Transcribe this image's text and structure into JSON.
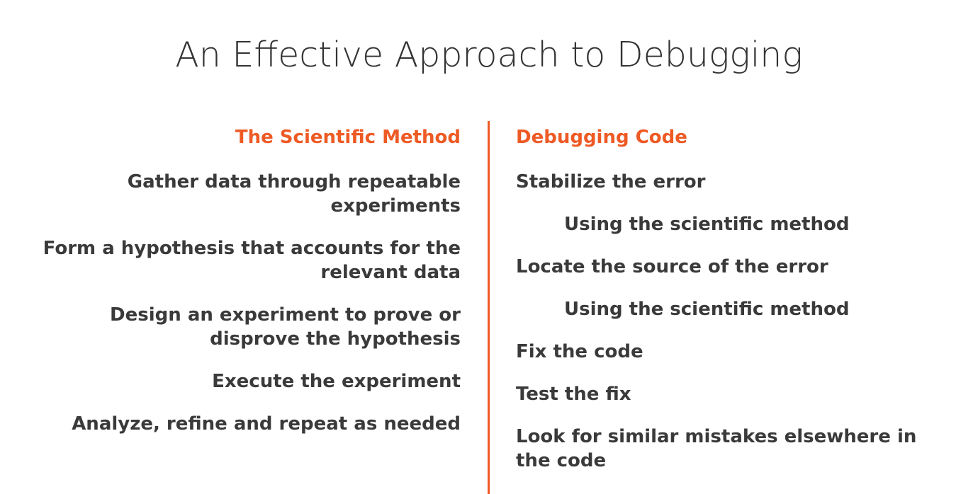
{
  "title": "An Effective Approach to Debugging",
  "accent_color": "#ee5a24",
  "text_color": "#3a3a3a",
  "left_column": {
    "heading": "The Scientific Method",
    "items": [
      {
        "line1": "Gather data through repeatable",
        "line2": "experiments"
      },
      {
        "line1": "Form a hypothesis that accounts for the",
        "line2": "relevant data"
      },
      {
        "line1": "Design an experiment to prove or",
        "line2": "disprove the hypothesis"
      },
      {
        "line1": "Execute the experiment"
      },
      {
        "line1": "Analyze, refine and repeat as needed"
      }
    ]
  },
  "right_column": {
    "heading": "Debugging Code",
    "items": [
      {
        "text": "Stabilize the error"
      },
      {
        "text": "Using the scientific method"
      },
      {
        "text": "Locate the source of the error"
      },
      {
        "text": "Using the scientific method"
      },
      {
        "text": "Fix the code"
      },
      {
        "text": "Test the fix"
      },
      {
        "text": "Look for similar mistakes elsewhere in the code"
      }
    ]
  }
}
